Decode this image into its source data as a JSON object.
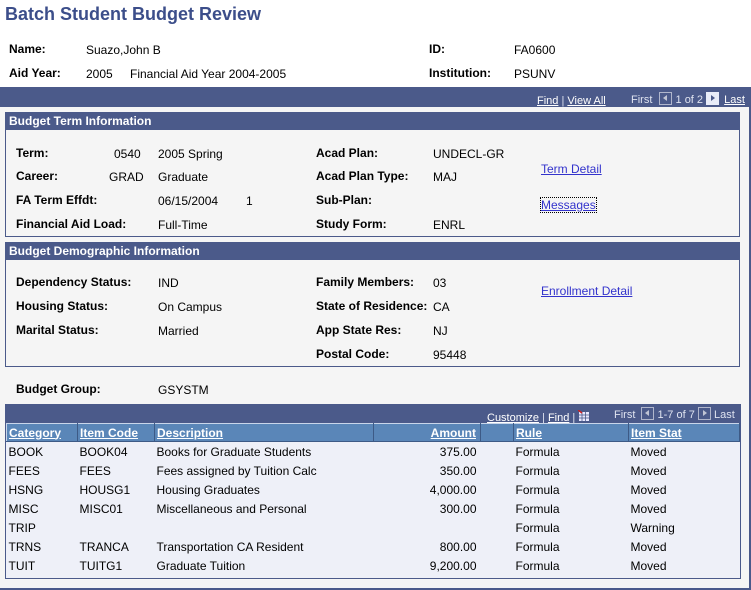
{
  "page": {
    "title": "Batch Student Budget Review"
  },
  "header": {
    "name_label": "Name:",
    "name_value": "Suazo,John B",
    "aid_year_label": "Aid Year:",
    "aid_year_value": "2005",
    "aid_year_desc": "Financial Aid Year 2004-2005",
    "id_label": "ID:",
    "id_value": "FA0600",
    "institution_label": "Institution:",
    "institution_value": "PSUNV"
  },
  "nav": {
    "find": "Find",
    "sep": "|",
    "view_all": "View All",
    "first": "First",
    "count": "1 of 2",
    "last": "Last"
  },
  "term": {
    "title": "Budget Term Information",
    "term_label": "Term:",
    "term_code": "0540",
    "term_desc": "2005 Spring",
    "career_label": "Career:",
    "career_code": "GRAD",
    "career_desc": "Graduate",
    "effdt_label": "FA Term Effdt:",
    "effdt_value": "06/15/2004",
    "effdt_seq": "1",
    "load_label": "Financial Aid Load:",
    "load_value": "Full-Time",
    "plan_label": "Acad Plan:",
    "plan_value": "UNDECL-GR",
    "plan_type_label": "Acad Plan Type:",
    "plan_type_value": "MAJ",
    "subplan_label": "Sub-Plan:",
    "subplan_value": "",
    "study_label": "Study Form:",
    "study_value": "ENRL",
    "term_detail_link": "Term Detail",
    "messages_link": "Messages"
  },
  "demo": {
    "title": "Budget Demographic Information",
    "dep_label": "Dependency Status:",
    "dep_value": "IND",
    "housing_label": "Housing Status:",
    "housing_value": "On Campus",
    "marital_label": "Marital Status:",
    "marital_value": "Married",
    "family_label": "Family Members:",
    "family_value": "03",
    "state_label": "State of Residence:",
    "state_value": "CA",
    "app_state_label": "App State Res:",
    "app_state_value": "NJ",
    "postal_label": "Postal Code:",
    "postal_value": "95448",
    "enroll_link": "Enrollment Detail"
  },
  "budget_group": {
    "label": "Budget Group:",
    "value": "GSYSTM"
  },
  "grid": {
    "customize": "Customize",
    "find": "Find",
    "sep": "|",
    "first": "First",
    "count": "1-7 of 7",
    "last": "Last",
    "columns": [
      "Category",
      "Item Code",
      "Description",
      "Amount",
      "",
      "Rule",
      "Item Stat"
    ],
    "rows": [
      [
        "BOOK",
        "BOOK04",
        "Books for Graduate Students",
        "375.00",
        "",
        "Formula",
        "Moved"
      ],
      [
        "FEES",
        "FEES",
        "Fees assigned by Tuition Calc",
        "350.00",
        "",
        "Formula",
        "Moved"
      ],
      [
        "HSNG",
        "HOUSG1",
        "Housing Graduates",
        "4,000.00",
        "",
        "Formula",
        "Moved"
      ],
      [
        "MISC",
        "MISC01",
        "Miscellaneous and Personal",
        "300.00",
        "",
        "Formula",
        "Moved"
      ],
      [
        "TRIP",
        "",
        "",
        "",
        "",
        "Formula",
        "Warning"
      ],
      [
        "TRNS",
        "TRANCA",
        "Transportation CA Resident",
        "800.00",
        "",
        "Formula",
        "Moved"
      ],
      [
        "TUIT",
        "TUITG1",
        "Graduate Tuition",
        "9,200.00",
        "",
        "Formula",
        "Moved"
      ]
    ]
  }
}
